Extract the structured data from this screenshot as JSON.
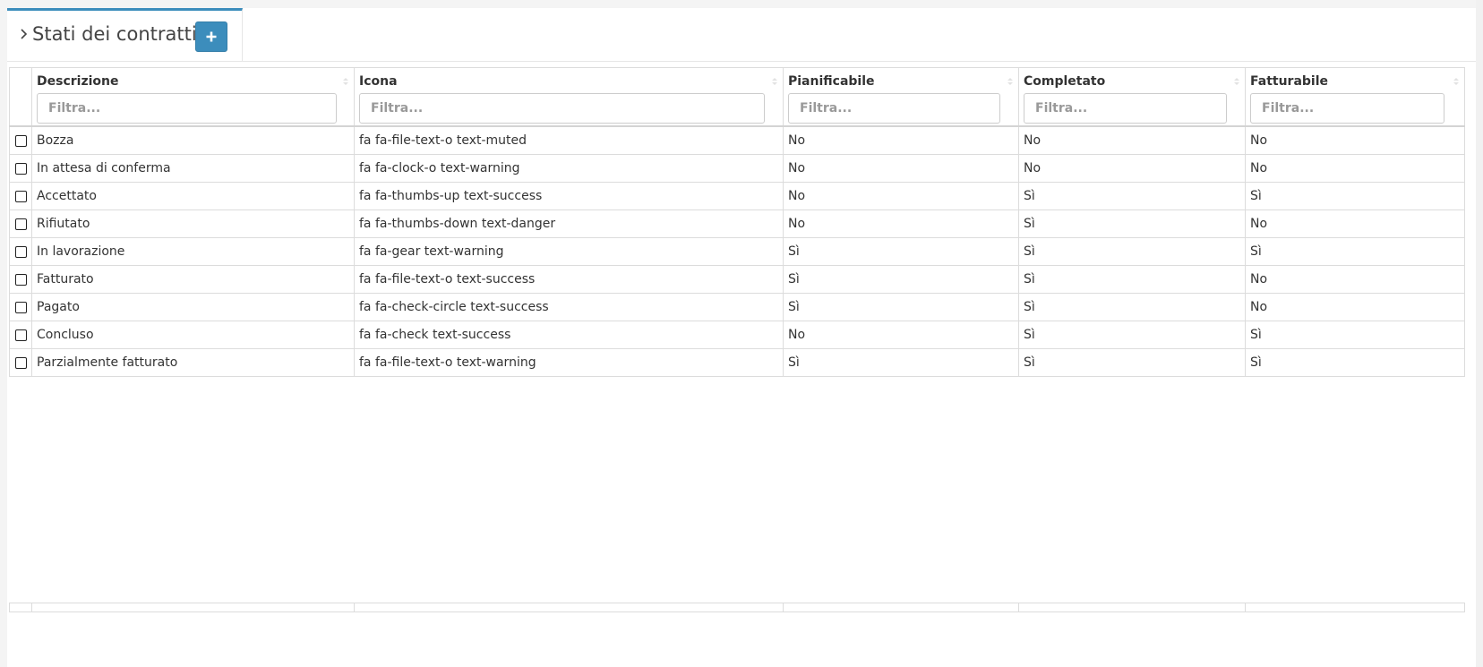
{
  "tab": {
    "title": "Stati dei contratti",
    "add_button_label": "+"
  },
  "table": {
    "headers": [
      "Descrizione",
      "Icona",
      "Pianificabile",
      "Completato",
      "Fatturabile"
    ],
    "filter_placeholder": "Filtra...",
    "rows": [
      [
        "Bozza",
        "fa fa-file-text-o text-muted",
        "No",
        "No",
        "No"
      ],
      [
        "In attesa di conferma",
        "fa fa-clock-o text-warning",
        "No",
        "No",
        "No"
      ],
      [
        "Accettato",
        "fa fa-thumbs-up text-success",
        "No",
        "Sì",
        "Sì"
      ],
      [
        "Rifiutato",
        "fa fa-thumbs-down text-danger",
        "No",
        "Sì",
        "No"
      ],
      [
        "In lavorazione",
        "fa fa-gear text-warning",
        "Sì",
        "Sì",
        "Sì"
      ],
      [
        "Fatturato",
        "fa fa-file-text-o text-success",
        "Sì",
        "Sì",
        "No"
      ],
      [
        "Pagato",
        "fa fa-check-circle text-success",
        "Sì",
        "Sì",
        "No"
      ],
      [
        "Concluso",
        "fa fa-check text-success",
        "No",
        "Sì",
        "Sì"
      ],
      [
        "Parzialmente fatturato",
        "fa fa-file-text-o text-warning",
        "Sì",
        "Sì",
        "Sì"
      ]
    ]
  },
  "icons": {
    "tab_toggle": "chevron-right-icon",
    "add": "plus-icon",
    "sort": "sort-icon"
  },
  "colors": {
    "accent": "#3c8dbc",
    "border": "#dcdcdc"
  }
}
